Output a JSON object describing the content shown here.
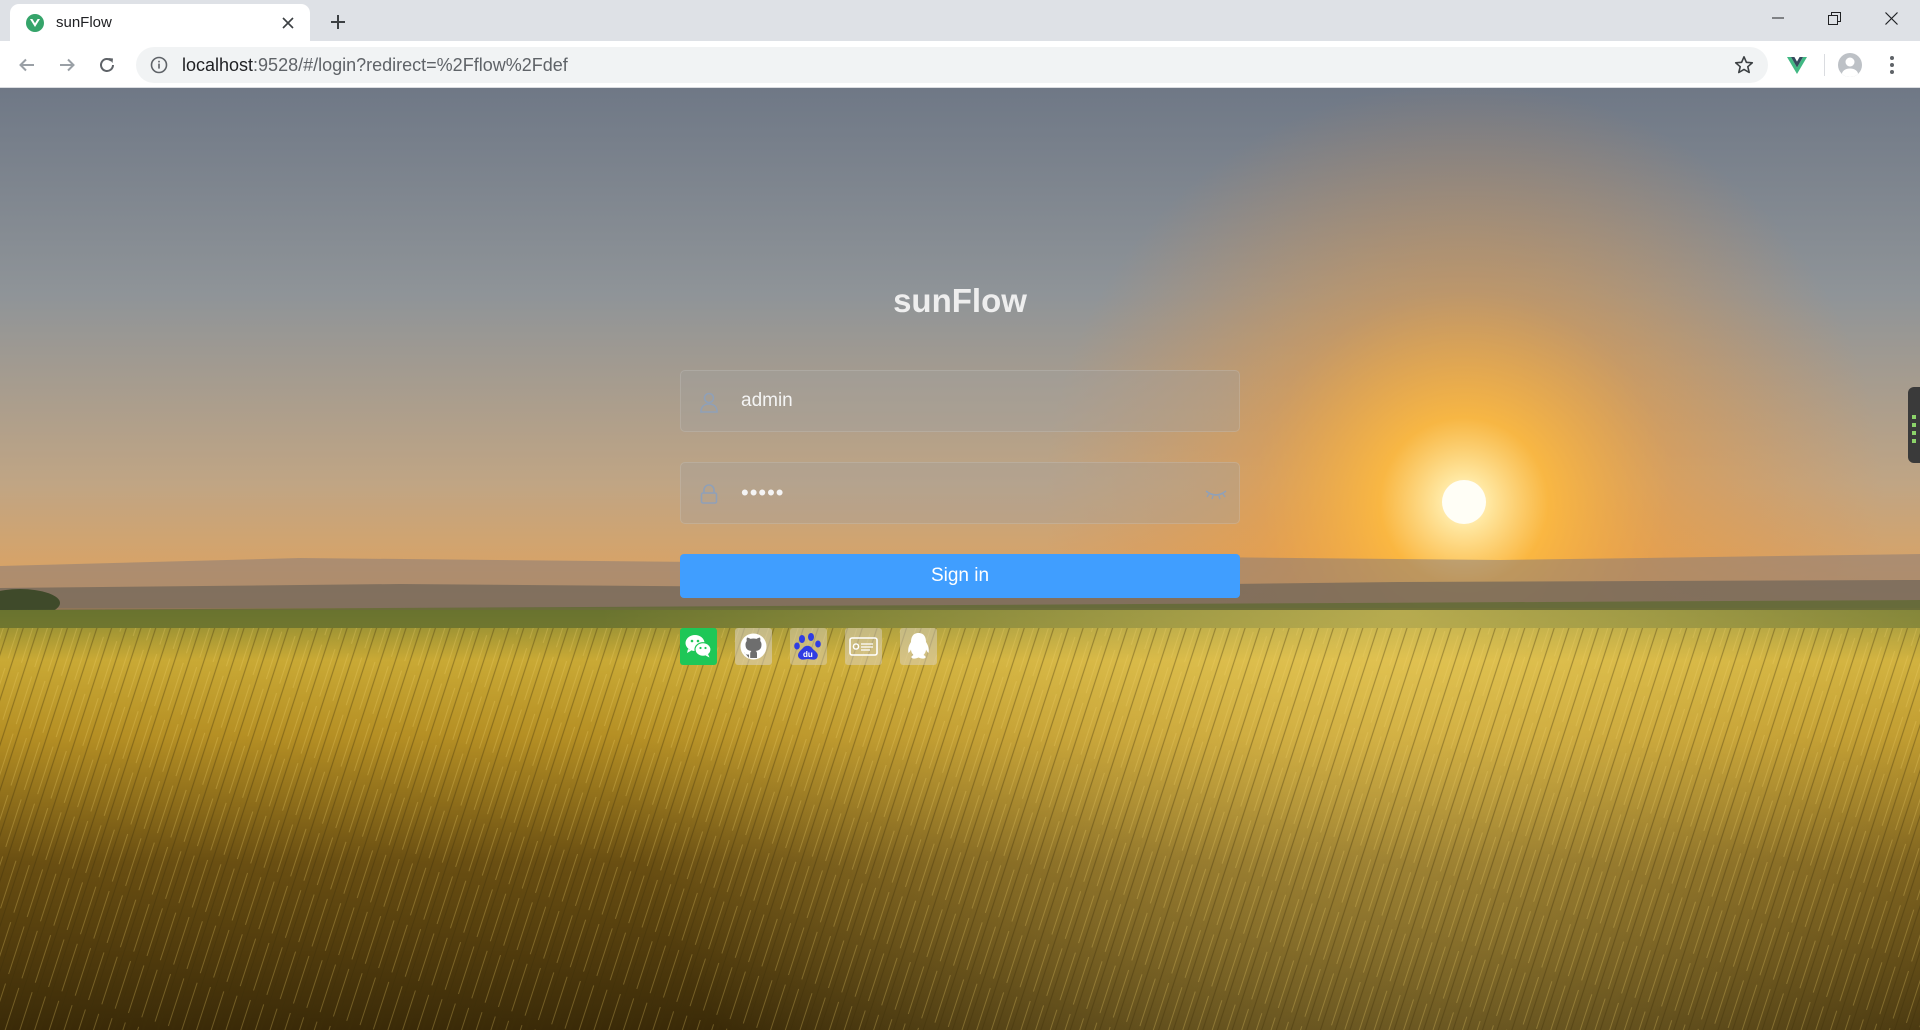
{
  "browser": {
    "tab_title": "sunFlow",
    "url_host": "localhost",
    "url_rest": ":9528/#/login?redirect=%2Fflow%2Fdef",
    "icons": {
      "back": "arrow-left-icon",
      "forward": "arrow-right-icon",
      "reload": "reload-icon",
      "info": "info-icon",
      "bookmark": "star-icon",
      "extension": "vue-devtools-icon",
      "profile": "avatar-icon",
      "menu": "kebab-menu-icon"
    }
  },
  "login": {
    "title": "sunFlow",
    "username_value": "admin",
    "password_value": "•••••",
    "signin_label": "Sign in",
    "social": [
      "wechat",
      "github",
      "baidu",
      "weibo",
      "qq"
    ]
  },
  "colors": {
    "primary": "#409eff",
    "wechat": "#1ec757",
    "baidu": "#2f3ce3",
    "title": "#eeeeee"
  }
}
